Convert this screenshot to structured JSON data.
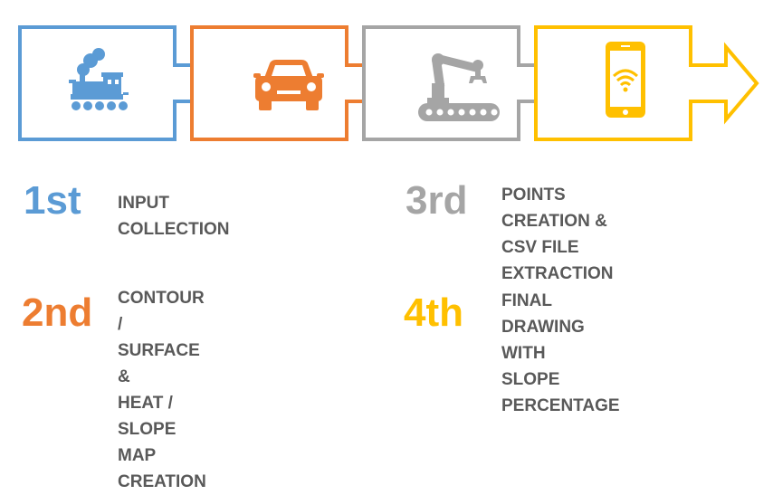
{
  "colors": {
    "blue": "#5b9bd5",
    "orange": "#ed7d31",
    "gray": "#a5a5a5",
    "yellow": "#ffc000",
    "text": "#595959"
  },
  "stages": [
    {
      "icon": "steam-locomotive-icon",
      "color": "#5b9bd5"
    },
    {
      "icon": "car-icon",
      "color": "#ed7d31"
    },
    {
      "icon": "robotic-arm-icon",
      "color": "#a5a5a5"
    },
    {
      "icon": "smartphone-wifi-icon",
      "color": "#ffc000"
    }
  ],
  "steps": [
    {
      "ordinal": "1st",
      "text": "INPUT COLLECTION"
    },
    {
      "ordinal": "2nd",
      "text": "CONTOUR / SURFACE &\nHEAT / SLOPE MAP\nCREATION"
    },
    {
      "ordinal": "3rd",
      "text": "POINTS CREATION &\nCSV FILE EXTRACTION"
    },
    {
      "ordinal": "4th",
      "text": "FINAL DRAWING WITH\nSLOPE PERCENTAGE"
    }
  ]
}
